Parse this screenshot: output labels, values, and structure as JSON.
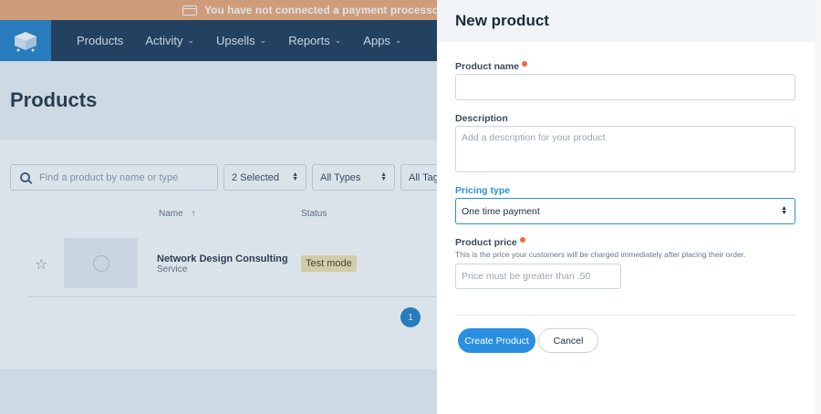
{
  "banner": {
    "text": "You have not connected a payment processor. Click here",
    "icon": "credit-card-icon"
  },
  "nav": {
    "items": [
      {
        "label": "Products",
        "has_dropdown": false
      },
      {
        "label": "Activity",
        "has_dropdown": true
      },
      {
        "label": "Upsells",
        "has_dropdown": true
      },
      {
        "label": "Reports",
        "has_dropdown": true
      },
      {
        "label": "Apps",
        "has_dropdown": true
      }
    ]
  },
  "page": {
    "title": "Products"
  },
  "filters": {
    "search_placeholder": "Find a product by name or type",
    "selected": "2 Selected",
    "types": "All Types",
    "tags": "All Tags"
  },
  "table": {
    "columns": [
      {
        "label": "Name",
        "sort": "ascending"
      },
      {
        "label": "Status"
      }
    ],
    "rows": [
      {
        "name": "Network Design Consulting",
        "type": "Service",
        "status": "Test mode"
      }
    ]
  },
  "pagination": {
    "current": "1"
  },
  "drawer": {
    "title": "New product",
    "product_name": {
      "label": "Product name",
      "required": true,
      "value": ""
    },
    "description": {
      "label": "Description",
      "placeholder": "Add a description for your product"
    },
    "pricing_type": {
      "label": "Pricing type",
      "value": "One time payment"
    },
    "product_price": {
      "label": "Product price",
      "required": true,
      "hint": "This is the price your customers will be charged immediately after placing their order.",
      "placeholder": "Price must be greater than .50"
    },
    "create_button": "Create Product",
    "cancel_button": "Cancel"
  },
  "colors": {
    "banner": "#f0a46f",
    "nav_bg": "#14304f",
    "accent": "#2a8fe0",
    "required_dot": "#f06a3c",
    "status_test_mode": "#f3e3a8"
  }
}
